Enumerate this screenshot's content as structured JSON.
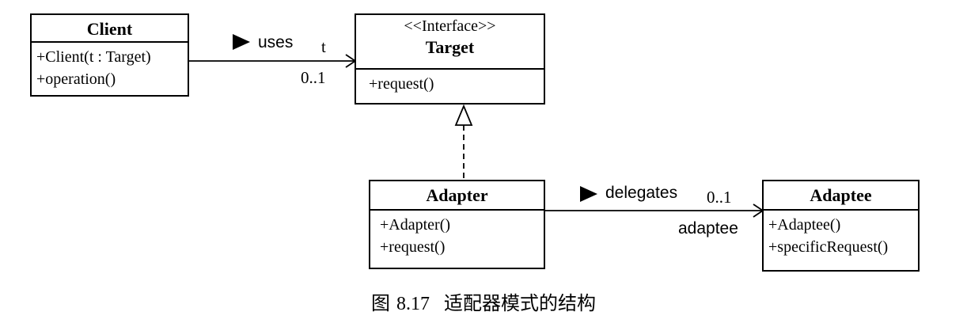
{
  "client": {
    "title": "Client",
    "ops": [
      "+Client(t : Target)",
      "+operation()"
    ]
  },
  "target": {
    "stereotype": "<<Interface>>",
    "title": "Target",
    "ops": [
      "+request()"
    ]
  },
  "adapter": {
    "title": "Adapter",
    "ops": [
      "+Adapter()",
      "+request()"
    ]
  },
  "adaptee": {
    "title": "Adaptee",
    "ops": [
      "+Adaptee()",
      "+specificRequest()"
    ]
  },
  "uses_assoc": {
    "label": "uses",
    "role": "t",
    "multiplicity": "0..1"
  },
  "delegates_assoc": {
    "label": "delegates",
    "role": "adaptee",
    "multiplicity": "0..1"
  },
  "caption": {
    "prefix": "图",
    "number": "8.17",
    "text": "适配器模式的结构"
  }
}
